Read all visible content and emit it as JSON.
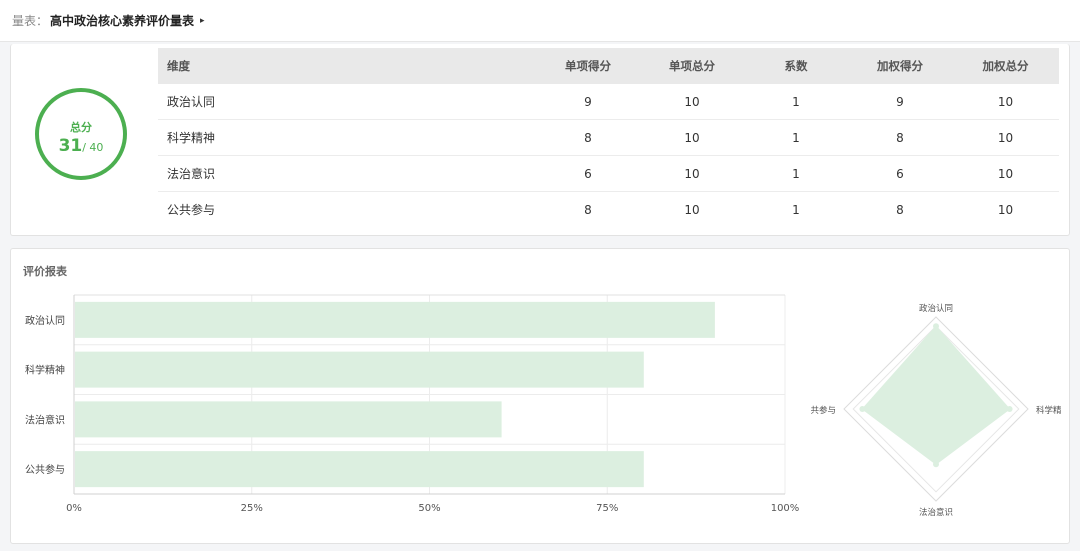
{
  "header": {
    "label": "量表：",
    "title": "高中政治核心素养评价量表",
    "caret": "▸"
  },
  "summary": {
    "label": "总分",
    "score": "31",
    "total": "/ 40",
    "accent": "#4caf50"
  },
  "table": {
    "headers": [
      "维度",
      "单项得分",
      "单项总分",
      "系数",
      "加权得分",
      "加权总分"
    ],
    "rows": [
      [
        "政治认同",
        "9",
        "10",
        "1",
        "9",
        "10"
      ],
      [
        "科学精神",
        "8",
        "10",
        "1",
        "8",
        "10"
      ],
      [
        "法治意识",
        "6",
        "10",
        "1",
        "6",
        "10"
      ],
      [
        "公共参与",
        "8",
        "10",
        "1",
        "8",
        "10"
      ]
    ]
  },
  "report": {
    "title": "评价报表"
  },
  "chart_data": [
    {
      "type": "bar",
      "orientation": "horizontal",
      "categories": [
        "政治认同",
        "科学精神",
        "法治意识",
        "公共参与"
      ],
      "values": [
        90,
        80,
        60,
        80
      ],
      "xlim": [
        0,
        100
      ],
      "xticks": [
        "0%",
        "25%",
        "50%",
        "75%",
        "100%"
      ],
      "grid": true,
      "bar_color": "#dcefe0"
    },
    {
      "type": "radar",
      "axes": [
        "政治认同",
        "科学精神",
        "法治意识",
        "公共参与"
      ],
      "values": [
        90,
        80,
        60,
        80
      ],
      "max": 100,
      "fill_color": "#dcefe0"
    }
  ]
}
